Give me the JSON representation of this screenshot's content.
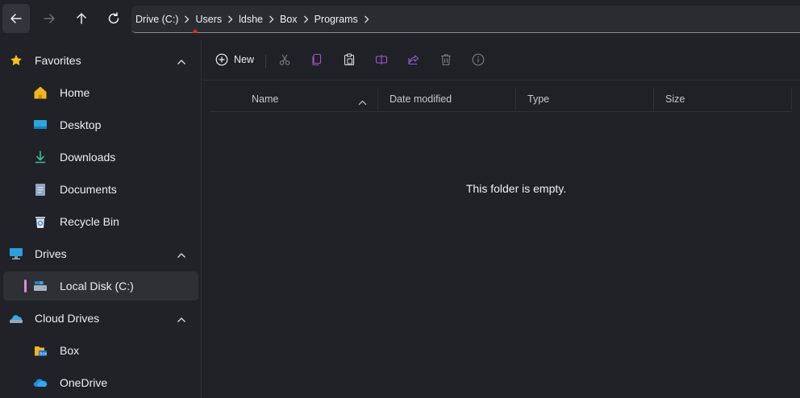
{
  "navigation": {
    "back": "back",
    "forward": "forward",
    "up": "up",
    "refresh": "refresh"
  },
  "breadcrumb": [
    "Drive (C:)",
    "Users",
    "ldshe",
    "Box",
    "Programs"
  ],
  "sidebar": {
    "sections": [
      {
        "label": "Favorites",
        "icon": "star-icon",
        "items": [
          {
            "label": "Home",
            "icon": "home-icon"
          },
          {
            "label": "Desktop",
            "icon": "desktop-icon"
          },
          {
            "label": "Downloads",
            "icon": "download-icon"
          },
          {
            "label": "Documents",
            "icon": "documents-icon"
          },
          {
            "label": "Recycle Bin",
            "icon": "recycle-bin-icon"
          }
        ]
      },
      {
        "label": "Drives",
        "icon": "monitor-icon",
        "items": [
          {
            "label": "Local Disk (C:)",
            "icon": "local-disk-icon",
            "selected": true
          }
        ]
      },
      {
        "label": "Cloud Drives",
        "icon": "cloud-drive-icon",
        "items": [
          {
            "label": "Box",
            "icon": "box-folder-icon"
          },
          {
            "label": "OneDrive",
            "icon": "onedrive-icon"
          }
        ]
      }
    ]
  },
  "toolbar": {
    "new_label": "New",
    "buttons": [
      "cut-icon",
      "copy-icon",
      "paste-icon",
      "rename-icon",
      "share-icon",
      "delete-icon",
      "properties-icon"
    ]
  },
  "columns": [
    "Name",
    "Date modified",
    "Type",
    "Size"
  ],
  "sort": {
    "column": "Name",
    "direction": "ascending"
  },
  "empty_message": "This folder is empty.",
  "colors": {
    "background": "#1f2127",
    "accent_selection": "#d58fd6",
    "star": "#f5c518",
    "home": "#f2b51d"
  }
}
